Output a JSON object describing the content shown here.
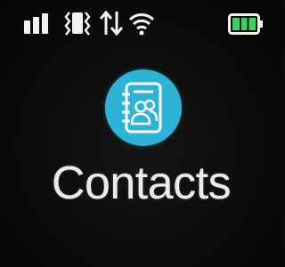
{
  "status_bar": {
    "icons": [
      "signal-strength-icon",
      "vibrate-icon",
      "data-transfer-icon",
      "wifi-icon",
      "battery-icon"
    ],
    "battery_level": 1.0,
    "battery_color": "#35d65a"
  },
  "app": {
    "label": "Contacts",
    "icon": "contacts-book-icon",
    "icon_color": "#2cb3d6"
  }
}
